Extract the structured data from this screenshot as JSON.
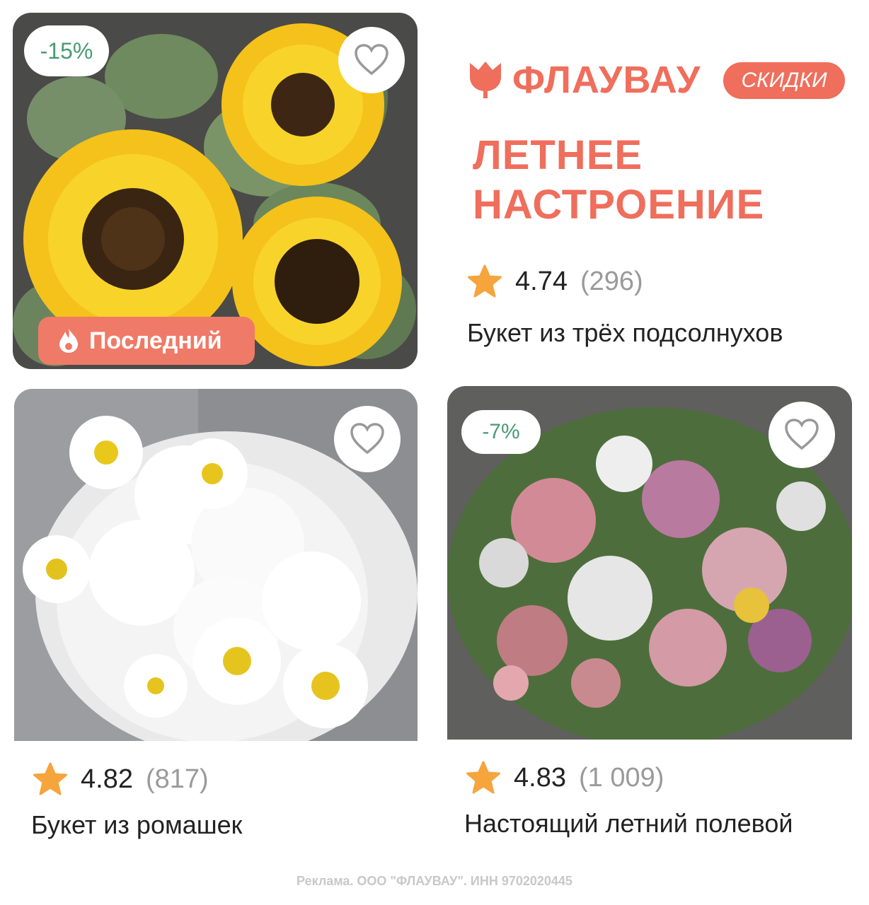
{
  "brand": {
    "name": "ФЛАУВАУ",
    "sale_label": "СКИДКИ",
    "headline_line1": "ЛЕТНЕЕ",
    "headline_line2": "НАСТРОЕНИЕ",
    "logo_icon": "tulip-icon",
    "accent_color": "#ef6e5c"
  },
  "products": [
    {
      "image": "sunflowers-photo",
      "discount": "-15%",
      "tag": "Последний",
      "tag_icon": "flame-icon",
      "rating": "4.74",
      "reviews": "(296)",
      "title": "Букет из трёх подсолнухов"
    },
    {
      "image": "daisies-photo",
      "rating": "4.82",
      "reviews": "(817)",
      "title": "Букет из ромашек"
    },
    {
      "image": "wildflowers-photo",
      "discount": "-7%",
      "rating": "4.83",
      "reviews": "(1 009)",
      "title": "Настоящий летний полевой"
    }
  ],
  "icons": {
    "favorite": "heart-outline-icon",
    "rating": "star-icon"
  },
  "footer": {
    "ad_text": "Реклама. ООО \"ФЛАУВАУ\". ИНН 9702020445"
  }
}
